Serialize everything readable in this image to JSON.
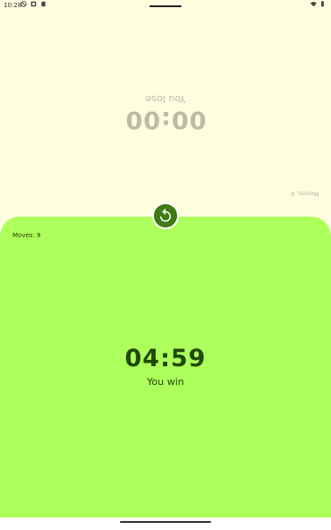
{
  "status_bar": {
    "time": "10:28",
    "icons": [
      "do-not-disturb-icon",
      "notification-icon",
      "sd-card-icon",
      "wifi-icon",
      "battery-icon"
    ]
  },
  "opponent": {
    "time": "00:00",
    "status": "You lose",
    "moves": "Moves: 9"
  },
  "player": {
    "time": "04:59",
    "status": "You win",
    "moves": "Moves: 9"
  },
  "restart_icon": "restart-icon",
  "colors": {
    "opponent_bg": "#fffde0",
    "player_bg": "#adff5c",
    "button_bg": "#3f7a15",
    "player_text": "#1f4a05",
    "opponent_text": "#bdbba5"
  }
}
